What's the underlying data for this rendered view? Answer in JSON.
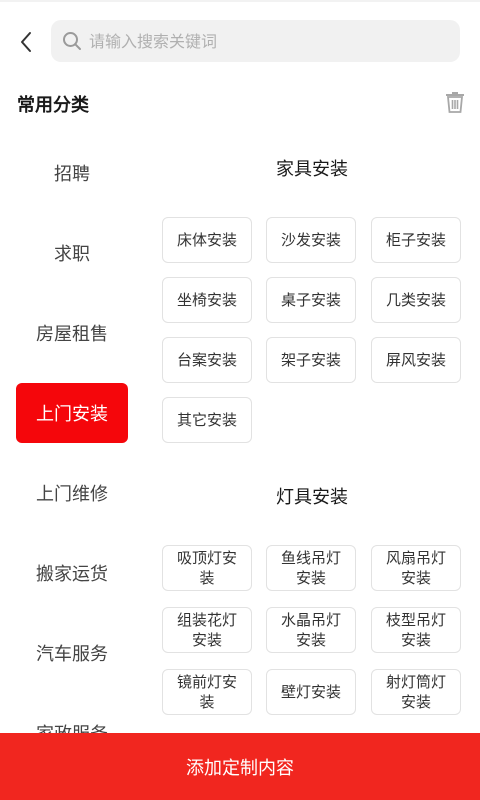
{
  "header": {
    "search_placeholder": "请输入搜索关键词"
  },
  "section": {
    "title": "常用分类"
  },
  "sidebar": {
    "items": [
      {
        "label": "招聘",
        "active": false
      },
      {
        "label": "求职",
        "active": false
      },
      {
        "label": "房屋租售",
        "active": false
      },
      {
        "label": "上门安装",
        "active": true
      },
      {
        "label": "上门维修",
        "active": false
      },
      {
        "label": "搬家运货",
        "active": false
      },
      {
        "label": "汽车服务",
        "active": false
      },
      {
        "label": "家政服务",
        "active": false
      }
    ]
  },
  "groups": [
    {
      "title": "家具安装",
      "items": [
        "床体安装",
        "沙发安装",
        "柜子安装",
        "坐椅安装",
        "桌子安装",
        "几类安装",
        "台案安装",
        "架子安装",
        "屏风安装",
        "其它安装"
      ]
    },
    {
      "title": "灯具安装",
      "items": [
        "吸顶灯安装",
        "鱼线吊灯安装",
        "风扇吊灯安装",
        "组装花灯安装",
        "水晶吊灯安装",
        "枝型吊灯安装",
        "镜前灯安装",
        "壁灯安装",
        "射灯筒灯安装"
      ]
    }
  ],
  "bottom": {
    "add_label": "添加定制内容"
  },
  "colors": {
    "accent": "#f5060b",
    "bottom_bar": "#f1261f",
    "search_bg": "#f1f1f1"
  },
  "icons": {
    "back": "chevron-left-icon",
    "search": "search-icon",
    "trash": "trash-icon"
  }
}
